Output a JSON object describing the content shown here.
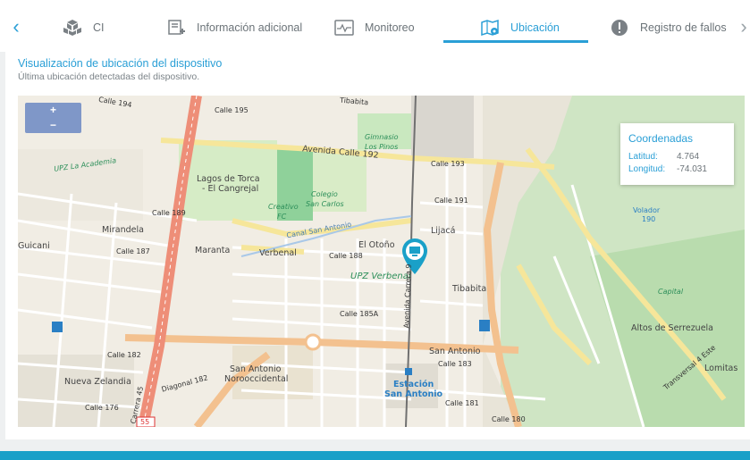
{
  "tabs": [
    {
      "label": "CI",
      "icon": "cubes-icon"
    },
    {
      "label": "Información adicional",
      "icon": "add-note-icon"
    },
    {
      "label": "Monitoreo",
      "icon": "monitor-icon"
    },
    {
      "label": "Ubicación",
      "icon": "map-pin-icon",
      "active": true
    },
    {
      "label": "Registro de fallos",
      "icon": "alert-icon"
    }
  ],
  "section": {
    "title": "Visualización de ubicación del dispositivo",
    "subtitle": "Última ubicación detectadas del dispositivo."
  },
  "map": {
    "zoom_in": "+",
    "zoom_out": "−",
    "labels": {
      "calle194": "Calle 194",
      "calle195": "Calle 195",
      "calle192": "Avenida Calle 192",
      "calle193": "Calle 193",
      "gimnasio": "Gimnasio",
      "lospinos": "Los Pinos",
      "upzacademia": "UPZ La Academia",
      "lagos1": "Lagos de Torca",
      "lagos2": "- El Cangrejal",
      "colegio1": "Colegio",
      "colegio2": "San Carlos",
      "creativo": "Creativo",
      "fc": "FC",
      "canal": "Canal San Antonio",
      "mirandela": "Mirandela",
      "guicani": "Guicani",
      "maranta": "Maranta",
      "verbenal": "Verbenal",
      "eloton": "El Otoño",
      "calle188": "Calle 188",
      "calle187": "Calle 187",
      "calle189": "Calle 189",
      "calle191": "Calle 191",
      "lijaca": "Lijacá",
      "upzverbenal": "UPZ Verbenal",
      "tibabita": "Tibabita",
      "sanantonio": "San Antonio",
      "sanantonio_noro1": "San Antonio",
      "sanantonio_noro2": "Norooccidental",
      "nuevazelandia": "Nueva Zelandia",
      "estacion1": "Estación",
      "estacion2": "San Antonio",
      "calle180": "Calle 180",
      "calle181": "Calle 181",
      "calle176": "Calle 176",
      "calle182": "Calle 182",
      "diagonal182": "Diagonal 182",
      "altos": "Altos de Serrezuela",
      "lomitas": "Lomitas",
      "capital": "Capital",
      "volador": "Volador",
      "volador_n": "190",
      "transversal": "Transversal 4 Este",
      "carrera9": "Avenida Carrera 9",
      "carrera45": "Carrera 45",
      "tibabita_top": "Tibabita",
      "route55": "55",
      "calle185a": "Calle 185A",
      "calle183": "Calle 183"
    }
  },
  "coordinates": {
    "title": "Coordenadas",
    "lat_label": "Latitud:",
    "lat_value": "4.764",
    "lon_label": "Longitud:",
    "lon_value": "-74.031"
  },
  "colors": {
    "accent": "#2a9fd6",
    "footer": "#1aa0c8",
    "pin": "#1aa0c8"
  }
}
